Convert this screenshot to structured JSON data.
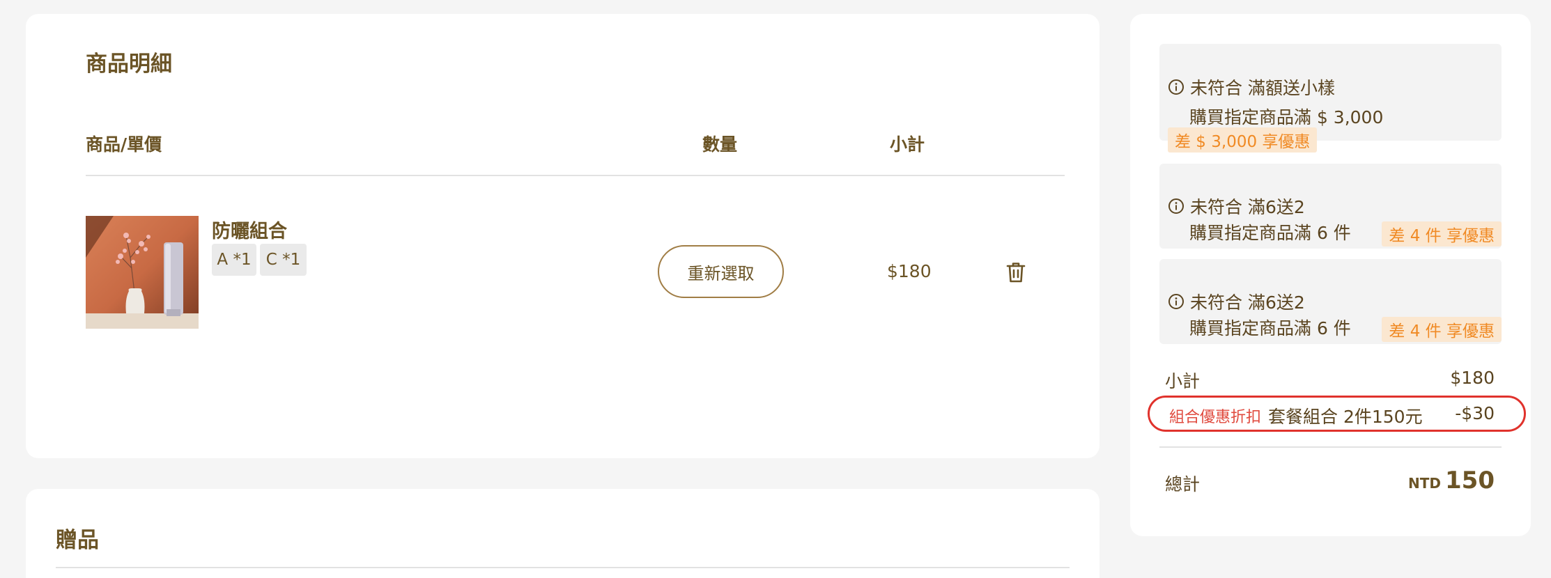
{
  "products": {
    "title": "商品明細",
    "columns": {
      "product": "商品/單價",
      "quantity": "數量",
      "subtotal": "小計"
    },
    "items": [
      {
        "name": "防曬組合",
        "variants": [
          "A *1",
          "C *1"
        ],
        "reselect_label": "重新選取",
        "price": "$180"
      }
    ]
  },
  "gift": {
    "title": "贈品"
  },
  "summary": {
    "promos": [
      {
        "status": "未符合",
        "name": "滿額送小樣",
        "condition": "購買指定商品滿 $ 3,000",
        "shortfall": "差 $ 3,000 享優惠"
      },
      {
        "status": "未符合",
        "name": "滿6送2",
        "condition": "購買指定商品滿 6 件",
        "shortfall": "差 4 件 享優惠"
      },
      {
        "status": "未符合",
        "name": "滿6送2",
        "condition": "購買指定商品滿 6 件",
        "shortfall": "差 4 件 享優惠"
      }
    ],
    "subtotal_label": "小計",
    "subtotal_value": "$180",
    "discount": {
      "tag": "組合優惠折扣",
      "description": "套餐組合 2件150元",
      "amount": "-$30"
    },
    "total_label": "總計",
    "total_currency": "NTD",
    "total_value": "150"
  },
  "colors": {
    "brand_text": "#6b5426",
    "badge_bg": "#fbe7d0",
    "badge_text": "#f08a24",
    "discount_red": "#e0322c"
  }
}
